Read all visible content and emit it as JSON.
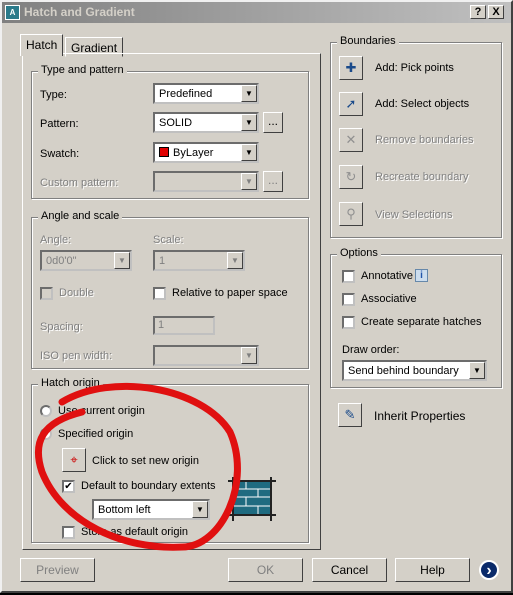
{
  "window": {
    "title": "Hatch and Gradient",
    "help": "?",
    "close": "X"
  },
  "tabs": [
    {
      "label": "Hatch",
      "active": true
    },
    {
      "label": "Gradient",
      "active": false
    }
  ],
  "type_pattern": {
    "heading": "Type and pattern",
    "type_label": "Type:",
    "type_value": "Predefined",
    "pattern_label": "Pattern:",
    "pattern_value": "SOLID",
    "browse": "...",
    "swatch_label": "Swatch:",
    "swatch_value": "ByLayer",
    "swatch_color": "#e00000",
    "custom_label": "Custom pattern:",
    "custom_value": ""
  },
  "angle_scale": {
    "heading": "Angle and scale",
    "angle_label": "Angle:",
    "angle_value": "0d0'0\"",
    "scale_label": "Scale:",
    "scale_value": "1",
    "double_label": "Double",
    "relative_label": "Relative to paper space",
    "spacing_label": "Spacing:",
    "spacing_value": "1",
    "iso_label": "ISO pen width:",
    "iso_value": ""
  },
  "origin": {
    "heading": "Hatch origin",
    "use_current": "Use current origin",
    "specified": "Specified origin",
    "click_set": "Click to set new origin",
    "default_extents": "Default to boundary extents",
    "default_extents_checked": true,
    "position_value": "Bottom left",
    "store_default": "Store as default origin",
    "store_default_checked": false
  },
  "boundaries": {
    "heading": "Boundaries",
    "items": [
      {
        "label": "Add: Pick points",
        "enabled": true
      },
      {
        "label": "Add: Select objects",
        "enabled": true
      },
      {
        "label": "Remove boundaries",
        "enabled": false
      },
      {
        "label": "Recreate boundary",
        "enabled": false
      },
      {
        "label": "View Selections",
        "enabled": false
      }
    ]
  },
  "options": {
    "heading": "Options",
    "annotative": "Annotative",
    "info": "i",
    "associative": "Associative",
    "separate": "Create separate hatches",
    "draw_order_label": "Draw order:",
    "draw_order_value": "Send behind boundary"
  },
  "inherit": "Inherit Properties",
  "footer": {
    "preview": "Preview",
    "ok": "OK",
    "cancel": "Cancel",
    "help": "Help",
    "more": "›"
  },
  "annotation_color": "#e01010"
}
